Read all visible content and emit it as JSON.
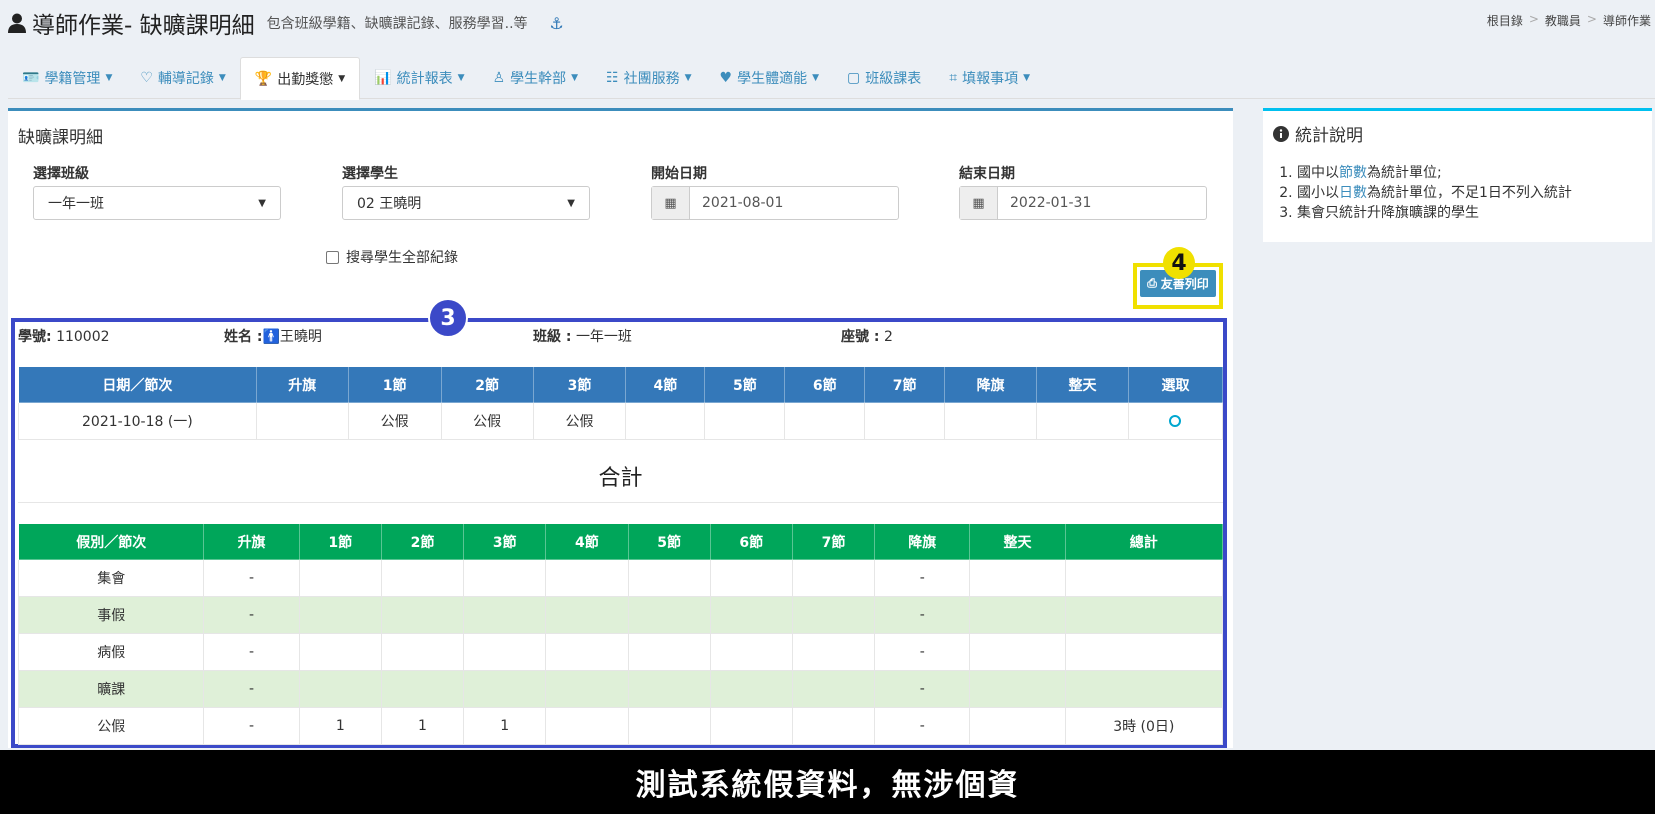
{
  "header": {
    "title": "導師作業- 缺曠課明細",
    "subtitle": "包含班級學籍、缺曠課記錄、服務學習..等",
    "anchor_icon": "anchor-icon",
    "breadcrumb": [
      "根目錄",
      "教職員",
      "導師作業"
    ]
  },
  "tabs": [
    {
      "label": "學籍管理",
      "icon": "id-card-icon"
    },
    {
      "label": "輔導記錄",
      "icon": "heart-icon"
    },
    {
      "label": "出勤獎懲",
      "icon": "trophy-icon"
    },
    {
      "label": "統計報表",
      "icon": "bar-chart-icon"
    },
    {
      "label": "學生幹部",
      "icon": "person-icon"
    },
    {
      "label": "社團服務",
      "icon": "group-icon"
    },
    {
      "label": "學生體適能",
      "icon": "heartbeat-icon"
    },
    {
      "label": "班級課表",
      "icon": "note-icon"
    },
    {
      "label": "填報事項",
      "icon": "frame-icon"
    }
  ],
  "panel": {
    "title": "缺曠課明細",
    "class_label": "選擇班級",
    "class_value": "一年一班",
    "student_label": "選擇學生",
    "student_value": "02 王曉明",
    "start_label": "開始日期",
    "start_value": "2021-08-01",
    "end_label": "結束日期",
    "end_value": "2022-01-31",
    "checkbox_label": "搜尋學生全部紀錄",
    "print_label": "友善列印"
  },
  "badges": {
    "b3": "3",
    "b4": "4"
  },
  "student": {
    "id_label": "學號:",
    "id": "110002",
    "name_label": "姓名 :",
    "name": "王曉明",
    "class_label": "班級 :",
    "class": "一年一班",
    "seat_label": "座號 :",
    "seat": "2"
  },
  "detail_table": {
    "headers": [
      "日期／節次",
      "升旗",
      "1節",
      "2節",
      "3節",
      "4節",
      "5節",
      "6節",
      "7節",
      "降旗",
      "整天",
      "選取"
    ],
    "rows": [
      [
        "2021-10-18 (一)",
        "",
        "公假",
        "公假",
        "公假",
        "",
        "",
        "",
        "",
        "",
        "",
        ""
      ]
    ]
  },
  "summary_title": "合計",
  "summary_table": {
    "headers": [
      "假別／節次",
      "升旗",
      "1節",
      "2節",
      "3節",
      "4節",
      "5節",
      "6節",
      "7節",
      "降旗",
      "整天",
      "總計"
    ],
    "rows": [
      [
        "集會",
        "-",
        "",
        "",
        "",
        "",
        "",
        "",
        "",
        "-",
        "",
        ""
      ],
      [
        "事假",
        "-",
        "",
        "",
        "",
        "",
        "",
        "",
        "",
        "-",
        "",
        ""
      ],
      [
        "病假",
        "-",
        "",
        "",
        "",
        "",
        "",
        "",
        "",
        "-",
        "",
        ""
      ],
      [
        "曠課",
        "-",
        "",
        "",
        "",
        "",
        "",
        "",
        "",
        "-",
        "",
        ""
      ],
      [
        "公假",
        "-",
        "1",
        "1",
        "1",
        "",
        "",
        "",
        "",
        "-",
        "",
        "3時 (0日)"
      ]
    ]
  },
  "side": {
    "title": "統計說明",
    "items": [
      {
        "pre": "國中以",
        "hl": "節數",
        "post": "為統計單位;"
      },
      {
        "pre": "國小以",
        "hl": "日數",
        "post": "為統計單位，不足1日不列入統計"
      },
      {
        "pre": "集會只統計升降旗曠課的學生",
        "hl": "",
        "post": ""
      }
    ]
  },
  "footer": "測試系統假資料，無涉個資"
}
